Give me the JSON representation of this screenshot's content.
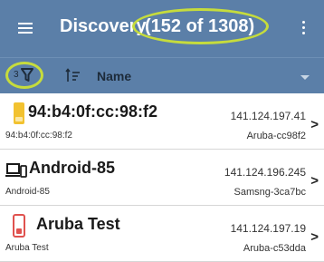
{
  "appbar": {
    "title": "Discovery",
    "count": "(152 of 1308)",
    "menu_icon": "hamburger-menu-icon",
    "overflow_icon": "vertical-dots-icon"
  },
  "toolbar": {
    "filter_count": "3",
    "filter_icon": "funnel-icon",
    "sort_icon": "sort-icon",
    "sort_label": "Name",
    "dropdown_icon": "caret-down-icon"
  },
  "devices": [
    {
      "name": "94:b4:0f:cc:98:f2",
      "sub": "94:b4:0f:cc:98:f2",
      "ip": "141.124.197.41",
      "vendor": "Aruba-cc98f2",
      "icon": "access-point-icon"
    },
    {
      "name": "Android-85",
      "sub": "Android-85",
      "ip": "141.124.196.245",
      "vendor": "Samsng-3ca7bc",
      "icon": "laptop-phone-icon"
    },
    {
      "name": "Aruba Test",
      "sub": "Aruba Test",
      "ip": "141.124.197.19",
      "vendor": "Aruba-c53dda",
      "icon": "access-point-icon"
    }
  ],
  "colors": {
    "appbar": "#5b7fa8",
    "highlight": "#c6dc3c",
    "ap_yellow": "#f2c230",
    "ap_red": "#e0524f"
  }
}
